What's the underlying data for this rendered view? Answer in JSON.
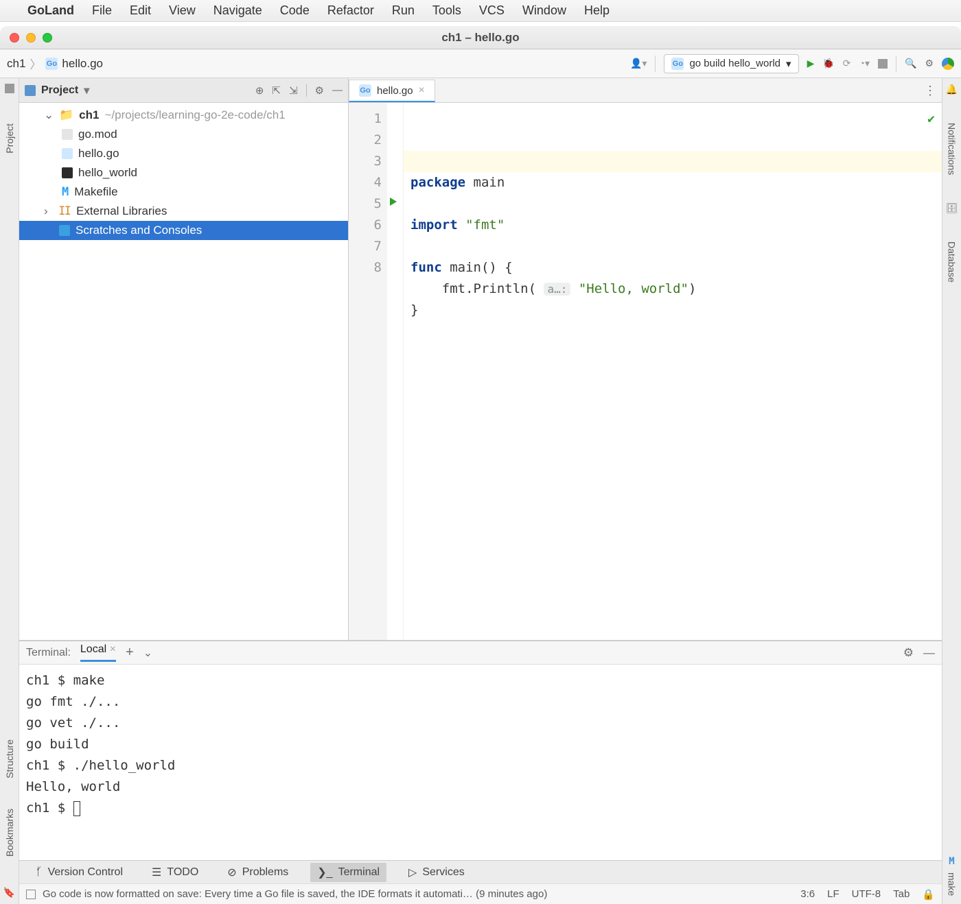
{
  "menubar": {
    "app": "GoLand",
    "items": [
      "File",
      "Edit",
      "View",
      "Navigate",
      "Code",
      "Refactor",
      "Run",
      "Tools",
      "VCS",
      "Window",
      "Help"
    ]
  },
  "window_title": "ch1 – hello.go",
  "breadcrumb": {
    "root": "ch1",
    "file": "hello.go"
  },
  "run_config": "go build hello_world",
  "project_panel": {
    "title": "Project",
    "root": {
      "name": "ch1",
      "path": "~/projects/learning-go-2e-code/ch1"
    },
    "children": [
      "go.mod",
      "hello.go",
      "hello_world",
      "Makefile"
    ],
    "ext_lib": "External Libraries",
    "scratches": "Scratches and Consoles"
  },
  "editor": {
    "tab": "hello.go",
    "lines": {
      "l1_kw": "package",
      "l1_id": "main",
      "l3_kw": "import",
      "l3_str": "\"fmt\"",
      "l5_kw": "func",
      "l5_id": "main",
      "l5_rest": "() {",
      "l6_pre": "    fmt.",
      "l6_fn": "Println",
      "l6_open": "( ",
      "l6_hint": "a…:",
      "l6_sep": " ",
      "l6_str": "\"Hello, world\"",
      "l6_close": ")",
      "l7": "}"
    }
  },
  "terminal": {
    "title": "Terminal:",
    "tab": "Local",
    "lines": [
      "ch1 $ make",
      "go fmt ./...",
      "go vet ./...",
      "go build",
      "ch1 $ ./hello_world",
      "Hello, world",
      "ch1 $ "
    ]
  },
  "tool_tabs": [
    "Version Control",
    "TODO",
    "Problems",
    "Terminal",
    "Services"
  ],
  "statusbar": {
    "msg": "Go code is now formatted on save: Every time a Go file is saved, the IDE formats it automati… (9 minutes ago)",
    "pos": "3:6",
    "eol": "LF",
    "enc": "UTF-8",
    "indent": "Tab"
  },
  "right_strip": {
    "a": "Notifications",
    "b": "Database"
  },
  "left_strip": {
    "a": "Project",
    "b": "Structure",
    "c": "Bookmarks"
  },
  "make_label": "make"
}
